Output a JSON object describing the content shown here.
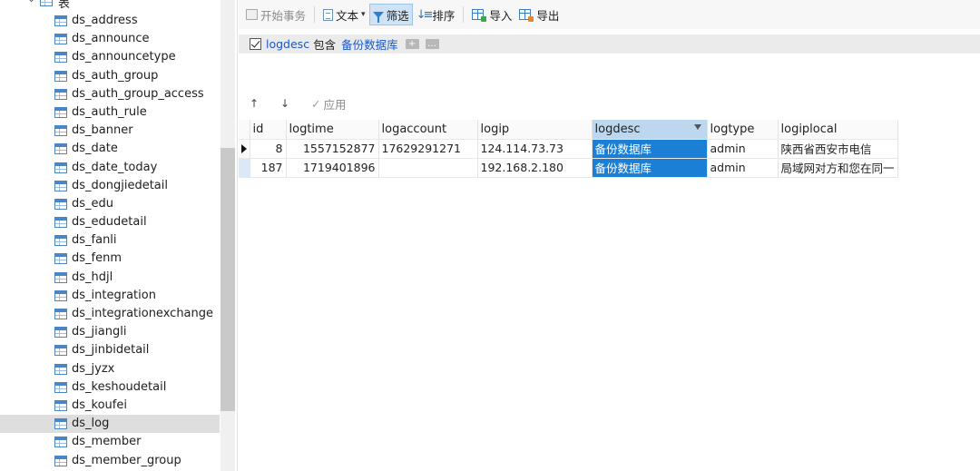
{
  "sidebar": {
    "root_label": "表",
    "items": [
      {
        "label": "ds_address"
      },
      {
        "label": "ds_announce"
      },
      {
        "label": "ds_announcetype"
      },
      {
        "label": "ds_auth_group"
      },
      {
        "label": "ds_auth_group_access"
      },
      {
        "label": "ds_auth_rule"
      },
      {
        "label": "ds_banner"
      },
      {
        "label": "ds_date"
      },
      {
        "label": "ds_date_today"
      },
      {
        "label": "ds_dongjiedetail"
      },
      {
        "label": "ds_edu"
      },
      {
        "label": "ds_edudetail"
      },
      {
        "label": "ds_fanli"
      },
      {
        "label": "ds_fenm"
      },
      {
        "label": "ds_hdjl"
      },
      {
        "label": "ds_integration"
      },
      {
        "label": "ds_integrationexchange"
      },
      {
        "label": "ds_jiangli"
      },
      {
        "label": "ds_jinbidetail"
      },
      {
        "label": "ds_jyzx"
      },
      {
        "label": "ds_keshoudetail"
      },
      {
        "label": "ds_koufei"
      },
      {
        "label": "ds_log"
      },
      {
        "label": "ds_member"
      },
      {
        "label": "ds_member_group"
      }
    ],
    "selected": "ds_log"
  },
  "toolbar": {
    "begin_transaction": "开始事务",
    "text": "文本",
    "filter": "筛选",
    "sort": "排序",
    "import": "导入",
    "export": "导出"
  },
  "filter": {
    "field": "logdesc",
    "operator": "包含",
    "value": "备份数据库",
    "add_symbol": "+",
    "more_symbol": "…"
  },
  "apply_row": {
    "up_symbol": "↑",
    "down_symbol": "↓",
    "apply_label": "应用"
  },
  "grid": {
    "columns": [
      "id",
      "logtime",
      "logaccount",
      "logip",
      "logdesc",
      "logtype",
      "logiplocal"
    ],
    "filtered_column": "logdesc",
    "rows": [
      {
        "id": "8",
        "logtime": "1557152877",
        "logaccount": "17629291271",
        "logip": "124.114.73.73",
        "logdesc": "备份数据库",
        "logtype": "admin",
        "logiplocal": "陕西省西安市电信"
      },
      {
        "id": "187",
        "logtime": "1719401896",
        "logaccount": "",
        "logip": "192.168.2.180",
        "logdesc": "备份数据库",
        "logtype": "admin",
        "logiplocal": "局域网对方和您在同一"
      }
    ]
  },
  "colors": {
    "selection": "#1c7fd6",
    "link_blue": "#1a57c7",
    "active_button": "#cfe3f6"
  }
}
